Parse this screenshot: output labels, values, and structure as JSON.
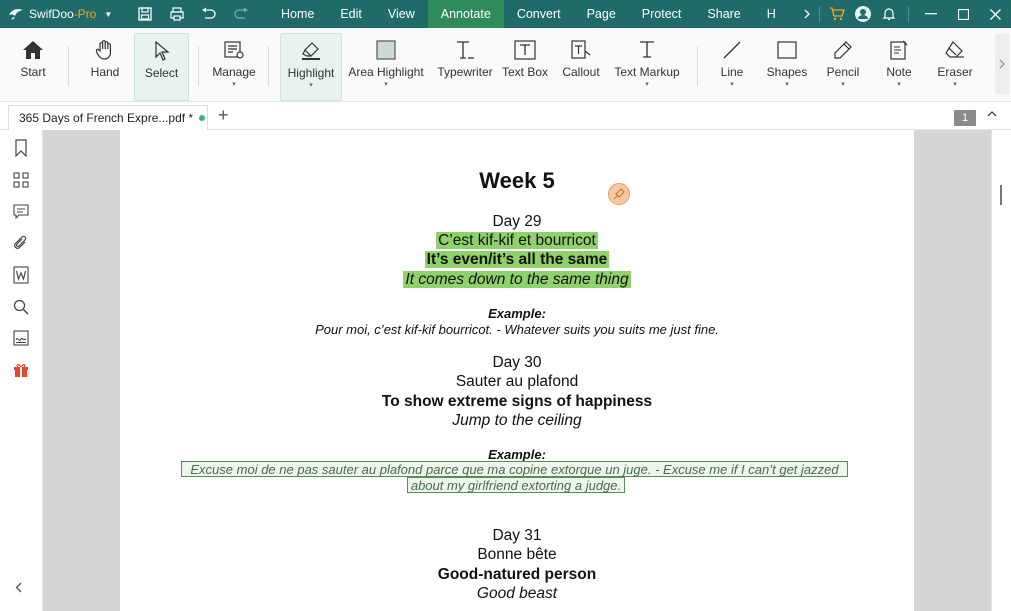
{
  "app": {
    "brand": "SwifDoo",
    "brand_suffix": "-Pro",
    "menu": [
      "Home",
      "Edit",
      "View",
      "Annotate",
      "Convert",
      "Page",
      "Protect",
      "Share",
      "H"
    ],
    "active_menu": "Annotate"
  },
  "toolbar": {
    "start": "Start",
    "hand": "Hand",
    "select": "Select",
    "manage": "Manage",
    "highlight": "Highlight",
    "area_highlight": "Area Highlight",
    "typewriter": "Typewriter",
    "text_box": "Text Box",
    "callout": "Callout",
    "text_markup": "Text Markup",
    "line": "Line",
    "shapes": "Shapes",
    "pencil": "Pencil",
    "note": "Note",
    "eraser": "Eraser"
  },
  "tabs": {
    "doc_title": "365 Days of French Expre...pdf *",
    "add": "+",
    "page_count": "1"
  },
  "document": {
    "title": "Week 5",
    "day29": {
      "day": "Day 29",
      "phrase": "C’est kif-kif et bourricot",
      "meaning": "It’s even/it’s all the same",
      "literal": "It comes down to the same thing",
      "example_label": "Example:",
      "example": "Pour moi, c’est kif-kif bourricot. - Whatever suits you suits me just fine."
    },
    "day30": {
      "day": "Day 30",
      "phrase": "Sauter au plafond",
      "meaning": "To show extreme signs of happiness",
      "literal": "Jump to the ceiling",
      "example_label": "Example:",
      "example_line1": "Excuse moi de ne pas sauter au plafond parce que ma copine extorque un juge. - Excuse me if I can’t get jazzed",
      "example_line2": "about my girlfriend extorting a judge."
    },
    "day31": {
      "day": "Day 31",
      "phrase": "Bonne bête",
      "meaning": "Good-natured person",
      "literal": "Good beast"
    }
  },
  "colors": {
    "titlebar": "#1f6b6a",
    "active_menu": "#2e8b5a",
    "highlight": "#8fd16a",
    "accent": "#f5a623"
  }
}
